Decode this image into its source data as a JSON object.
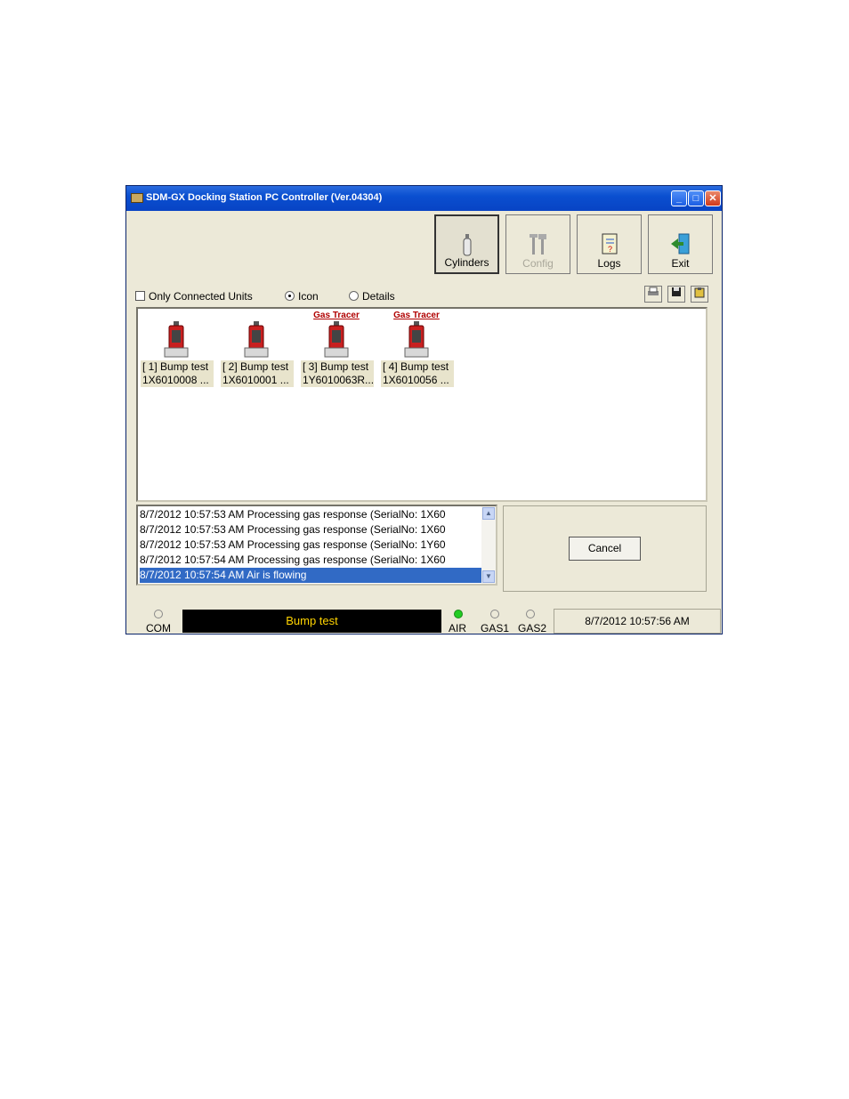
{
  "window": {
    "title": "SDM-GX Docking Station PC Controller (Ver.04304)"
  },
  "toolbar": {
    "buttons": [
      {
        "label": "Cylinders",
        "icon": "cylinder-icon",
        "enabled": true
      },
      {
        "label": "Config",
        "icon": "tools-icon",
        "enabled": false
      },
      {
        "label": "Logs",
        "icon": "logbook-icon",
        "enabled": true
      },
      {
        "label": "Exit",
        "icon": "exit-door-icon",
        "enabled": true
      }
    ]
  },
  "view_options": {
    "only_connected_label": "Only Connected Units",
    "only_connected_checked": false,
    "icon_label": "Icon",
    "details_label": "Details",
    "selected_view": "Icon",
    "actions": [
      "printer-icon",
      "save-icon",
      "clipboard-icon"
    ]
  },
  "units": [
    {
      "brand": "",
      "status": "[ 1] Bump test",
      "serial": "1X6010008 ..."
    },
    {
      "brand": "",
      "status": "[ 2] Bump test",
      "serial": "1X6010001 ..."
    },
    {
      "brand": "Gas Tracer",
      "status": "[ 3] Bump test",
      "serial": "1Y6010063R..."
    },
    {
      "brand": "Gas Tracer",
      "status": "[ 4] Bump test",
      "serial": "1X6010056 ..."
    }
  ],
  "log": {
    "lines": [
      "8/7/2012 10:57:53 AM Processing gas response (SerialNo: 1X60",
      "8/7/2012 10:57:53 AM Processing gas response (SerialNo: 1X60",
      "8/7/2012 10:57:53 AM Processing gas response (SerialNo: 1Y60",
      "8/7/2012 10:57:54 AM Processing gas response (SerialNo: 1X60",
      "8/7/2012 10:57:54 AM Air is flowing"
    ],
    "selected_index": 4
  },
  "cancel_label": "Cancel",
  "status": {
    "com_label": "COM",
    "message": "Bump test",
    "air_label": "AIR",
    "gas1_label": "GAS1",
    "gas2_label": "GAS2",
    "air_on": true,
    "datetime": "8/7/2012 10:57:56 AM",
    "message_color": "#ffd400"
  }
}
